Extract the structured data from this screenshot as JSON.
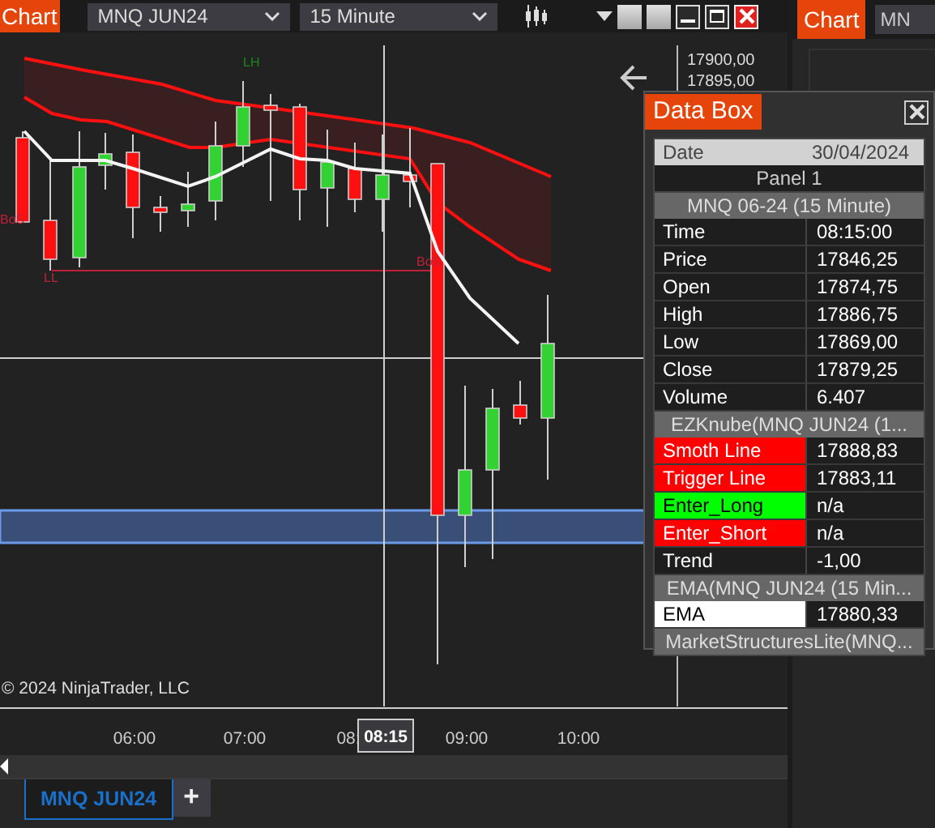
{
  "main_window": {
    "tab": "Chart",
    "instrument": "MNQ JUN24",
    "interval": "15 Minute"
  },
  "chart": {
    "labels": [
      {
        "text": "LH",
        "kind": "high"
      },
      {
        "text": "BoS",
        "kind": "bos"
      },
      {
        "text": "LL",
        "kind": "low"
      },
      {
        "text": "BoS",
        "kind": "bos"
      }
    ],
    "price_labels": [
      "17900,00",
      "17895,00"
    ],
    "copyright": "© 2024 NinjaTrader, LLC",
    "time_labels": [
      "06:00",
      "07:00",
      "08:",
      "09:00",
      "10:00"
    ],
    "crosshair_time": "08:15"
  },
  "bottom_tabs": [
    {
      "label": "MNQ JUN24",
      "selected": true
    }
  ],
  "add_tab": "+",
  "second_window": {
    "tab": "Chart",
    "instrument": "MN"
  },
  "data_box": {
    "title": "Data Box",
    "date_label": "Date",
    "date_value": "30/04/2024",
    "panel": "Panel 1",
    "sections": [
      {
        "header": "MNQ 06-24 (15 Minute)",
        "rows": [
          {
            "label": "Time",
            "value": "08:15:00"
          },
          {
            "label": "Price",
            "value": "17846,25"
          },
          {
            "label": "Open",
            "value": "17874,75"
          },
          {
            "label": "High",
            "value": "17886,75"
          },
          {
            "label": "Low",
            "value": "17869,00"
          },
          {
            "label": "Close",
            "value": "17879,25"
          },
          {
            "label": "Volume",
            "value": "6.407"
          }
        ]
      },
      {
        "header": "EZKnube(MNQ JUN24 (1...",
        "rows": [
          {
            "label": "Smoth Line",
            "value": "17888,83",
            "color": "#ff0000"
          },
          {
            "label": "Trigger Line",
            "value": "17883,11",
            "color": "#ff0000"
          },
          {
            "label": "Enter_Long",
            "value": "n/a",
            "color": "#00ff00"
          },
          {
            "label": "Enter_Short",
            "value": "n/a",
            "color": "#ff0000"
          },
          {
            "label": "Trend",
            "value": "-1,00"
          }
        ]
      },
      {
        "header": "EMA(MNQ JUN24 (15 Min...",
        "rows": [
          {
            "label": "EMA",
            "value": "17880,33",
            "color": "#ffffff"
          }
        ]
      },
      {
        "header": "MarketStructuresLite(MNQ..."
      }
    ]
  }
}
